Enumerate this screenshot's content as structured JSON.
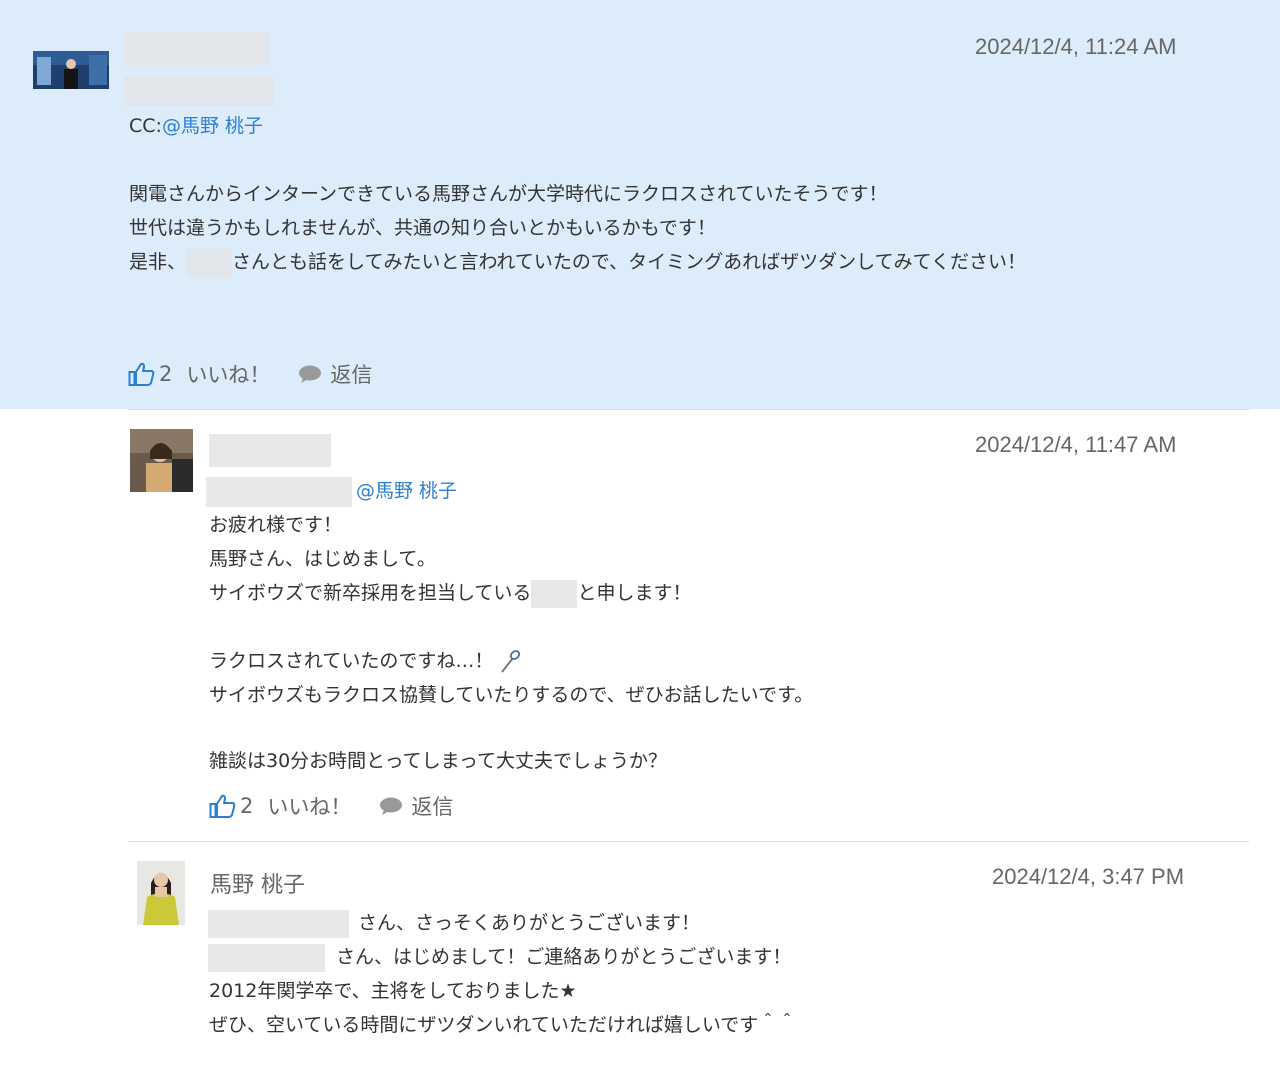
{
  "posts": [
    {
      "timestamp": "2024/12/4, 11:24 AM",
      "cc_prefix": "CC:",
      "mention": "@馬野 桃子",
      "line1": "関電さんからインターンできている馬野さんが大学時代にラクロスされていたそうです！",
      "line2": "世代は違うかもしれませんが、共通の知り合いとかもいるかもです！",
      "line3_start": "是非、",
      "line3_end": "さんとも話をしてみたいと言われていたので、タイミングあればザツダンしてみてください！",
      "like_count": "2",
      "like_label": "いいね！",
      "reply_label": "返信"
    },
    {
      "timestamp": "2024/12/4, 11:47 AM",
      "mention": "@馬野 桃子",
      "line1": "お疲れ様です！",
      "line2": "馬野さん、はじめまして。",
      "line3_start": "サイボウズで新卒採用を担当している",
      "line3_end": "と申します！",
      "line4": "ラクロスされていたのですね…！",
      "line5": "サイボウズもラクロス協賛していたりするので、ぜひお話したいです。",
      "line6": "雑談は30分お時間とってしまって大丈夫でしょうか？",
      "like_count": "2",
      "like_label": "いいね！",
      "reply_label": "返信"
    },
    {
      "author": "馬野 桃子",
      "timestamp": "2024/12/4, 3:47 PM",
      "line1_end": "さん、さっそくありがとうございます！",
      "line2_end": "さん、はじめまして！ご連絡ありがとうございます！",
      "line3": "2012年関学卒で、主将をしておりました★",
      "line4": "ぜひ、空いている時間にザツダンいれていただければ嬉しいです＾＾"
    }
  ],
  "colors": {
    "highlight_bg": "#dcecfb",
    "mention": "#2d7fd0",
    "text": "#333333",
    "muted": "#666666",
    "icon_blue": "#2d7fd0",
    "icon_gray": "#999999"
  },
  "icons": [
    "thumbs-up-icon",
    "speech-bubble-icon",
    "lacrosse-stick-icon"
  ]
}
